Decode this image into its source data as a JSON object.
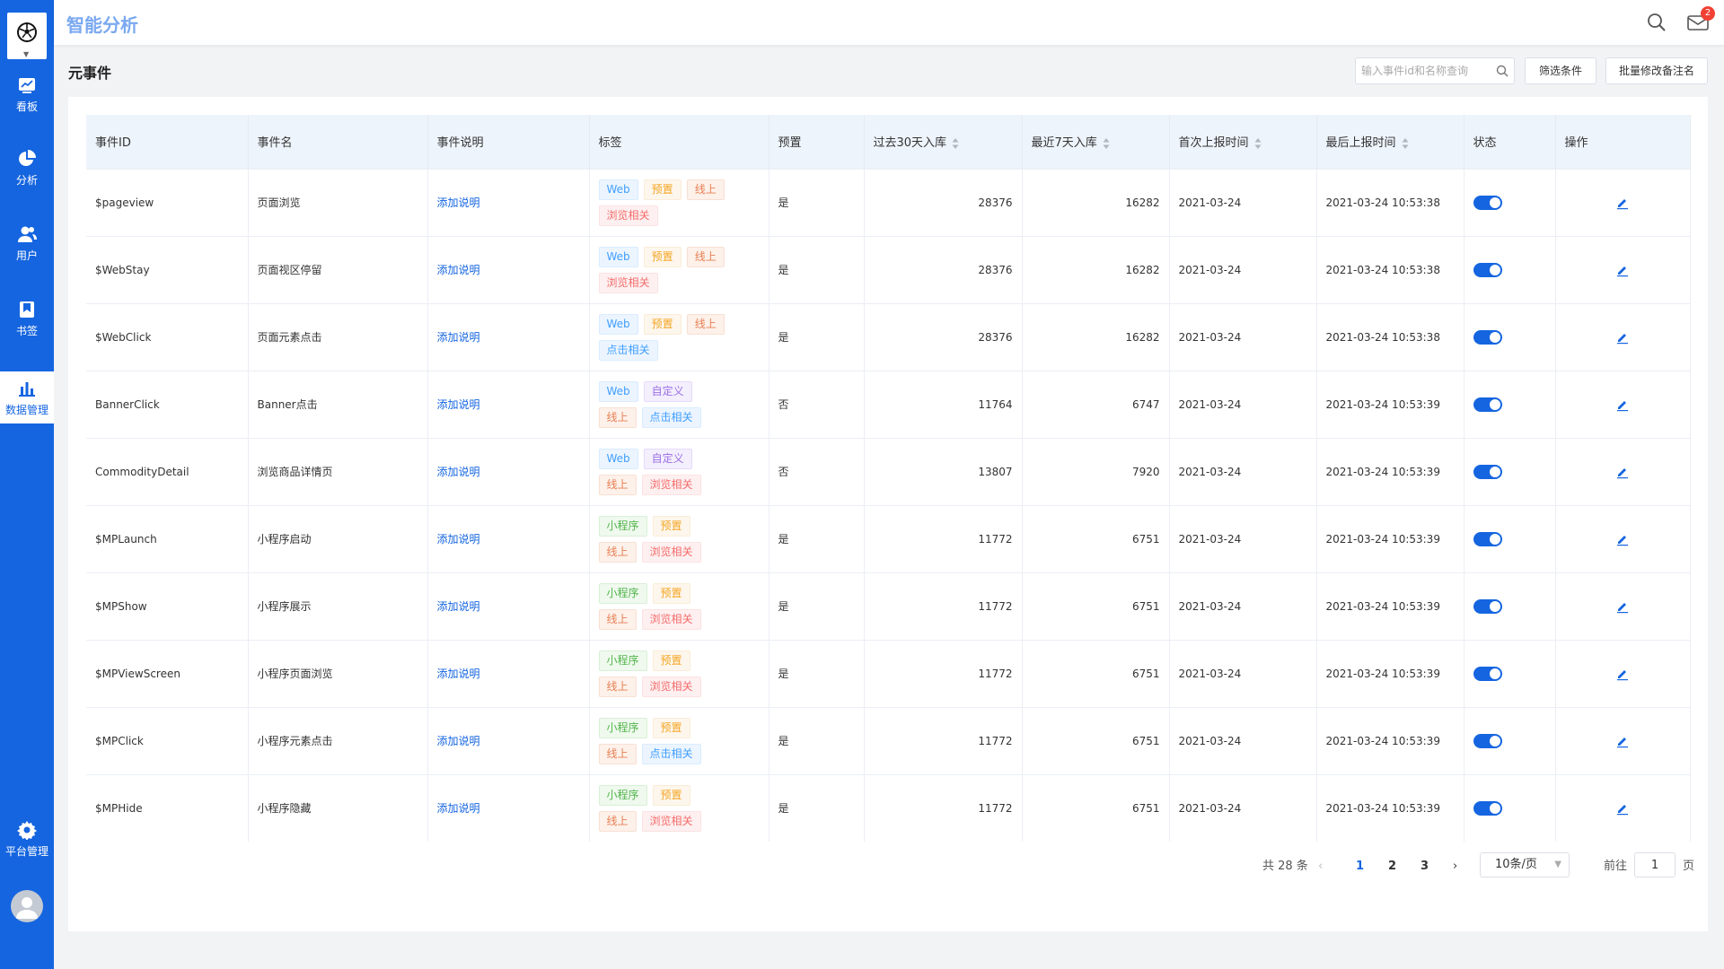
{
  "app": {
    "title": "智能分析",
    "mail_badge": "2"
  },
  "sidebar": {
    "items": [
      {
        "label": "看板",
        "icon": "dashboard-icon"
      },
      {
        "label": "分析",
        "icon": "pie-chart-icon"
      },
      {
        "label": "用户",
        "icon": "users-icon"
      },
      {
        "label": "书签",
        "icon": "bookmark-icon"
      },
      {
        "label": "数据管理",
        "icon": "bar-chart-icon",
        "active": true
      }
    ],
    "platform": {
      "label": "平台管理",
      "icon": "gear-icon"
    }
  },
  "toolbar": {
    "page_title": "元事件",
    "search_placeholder": "输入事件id和名称查询",
    "filter_label": "筛选条件",
    "batch_label": "批量修改备注名"
  },
  "table": {
    "headers": [
      "事件ID",
      "事件名",
      "事件说明",
      "标签",
      "预置",
      "过去30天入库",
      "最近7天入库",
      "首次上报时间",
      "最后上报时间",
      "状态",
      "操作"
    ],
    "rows": [
      {
        "id": "$pageview",
        "name": "页面浏览",
        "desc": "添加说明",
        "tags": [
          {
            "t": "Web",
            "c": "blue"
          },
          {
            "t": "预置",
            "c": "orange"
          },
          {
            "t": "线上",
            "c": "peach"
          },
          {
            "t": "浏览相关",
            "c": "pink"
          }
        ],
        "preset": "是",
        "d30": "28376",
        "d7": "16282",
        "first": "2021-03-24",
        "last": "2021-03-24 10:53:38",
        "enabled": true
      },
      {
        "id": "$WebStay",
        "name": "页面视区停留",
        "desc": "添加说明",
        "tags": [
          {
            "t": "Web",
            "c": "blue"
          },
          {
            "t": "预置",
            "c": "orange"
          },
          {
            "t": "线上",
            "c": "peach"
          },
          {
            "t": "浏览相关",
            "c": "pink"
          }
        ],
        "preset": "是",
        "d30": "28376",
        "d7": "16282",
        "first": "2021-03-24",
        "last": "2021-03-24 10:53:38",
        "enabled": true
      },
      {
        "id": "$WebClick",
        "name": "页面元素点击",
        "desc": "添加说明",
        "tags": [
          {
            "t": "Web",
            "c": "blue"
          },
          {
            "t": "预置",
            "c": "orange"
          },
          {
            "t": "线上",
            "c": "peach"
          },
          {
            "t": "点击相关",
            "c": "blue"
          }
        ],
        "preset": "是",
        "d30": "28376",
        "d7": "16282",
        "first": "2021-03-24",
        "last": "2021-03-24 10:53:38",
        "enabled": true
      },
      {
        "id": "BannerClick",
        "name": "Banner点击",
        "desc": "添加说明",
        "tags": [
          {
            "t": "Web",
            "c": "blue"
          },
          {
            "t": "自定义",
            "c": "purple"
          },
          {
            "t": "线上",
            "c": "peach"
          },
          {
            "t": "点击相关",
            "c": "blue"
          }
        ],
        "preset": "否",
        "d30": "11764",
        "d7": "6747",
        "first": "2021-03-24",
        "last": "2021-03-24 10:53:39",
        "enabled": true
      },
      {
        "id": "CommodityDetail",
        "name": "浏览商品详情页",
        "desc": "添加说明",
        "tags": [
          {
            "t": "Web",
            "c": "blue"
          },
          {
            "t": "自定义",
            "c": "purple"
          },
          {
            "t": "线上",
            "c": "peach"
          },
          {
            "t": "浏览相关",
            "c": "pink"
          }
        ],
        "preset": "否",
        "d30": "13807",
        "d7": "7920",
        "first": "2021-03-24",
        "last": "2021-03-24 10:53:39",
        "enabled": true
      },
      {
        "id": "$MPLaunch",
        "name": "小程序启动",
        "desc": "添加说明",
        "tags": [
          {
            "t": "小程序",
            "c": "green"
          },
          {
            "t": "预置",
            "c": "orange"
          },
          {
            "t": "线上",
            "c": "peach"
          },
          {
            "t": "浏览相关",
            "c": "pink"
          }
        ],
        "preset": "是",
        "d30": "11772",
        "d7": "6751",
        "first": "2021-03-24",
        "last": "2021-03-24 10:53:39",
        "enabled": true
      },
      {
        "id": "$MPShow",
        "name": "小程序展示",
        "desc": "添加说明",
        "tags": [
          {
            "t": "小程序",
            "c": "green"
          },
          {
            "t": "预置",
            "c": "orange"
          },
          {
            "t": "线上",
            "c": "peach"
          },
          {
            "t": "浏览相关",
            "c": "pink"
          }
        ],
        "preset": "是",
        "d30": "11772",
        "d7": "6751",
        "first": "2021-03-24",
        "last": "2021-03-24 10:53:39",
        "enabled": true
      },
      {
        "id": "$MPViewScreen",
        "name": "小程序页面浏览",
        "desc": "添加说明",
        "tags": [
          {
            "t": "小程序",
            "c": "green"
          },
          {
            "t": "预置",
            "c": "orange"
          },
          {
            "t": "线上",
            "c": "peach"
          },
          {
            "t": "浏览相关",
            "c": "pink"
          }
        ],
        "preset": "是",
        "d30": "11772",
        "d7": "6751",
        "first": "2021-03-24",
        "last": "2021-03-24 10:53:39",
        "enabled": true
      },
      {
        "id": "$MPClick",
        "name": "小程序元素点击",
        "desc": "添加说明",
        "tags": [
          {
            "t": "小程序",
            "c": "green"
          },
          {
            "t": "预置",
            "c": "orange"
          },
          {
            "t": "线上",
            "c": "peach"
          },
          {
            "t": "点击相关",
            "c": "blue"
          }
        ],
        "preset": "是",
        "d30": "11772",
        "d7": "6751",
        "first": "2021-03-24",
        "last": "2021-03-24 10:53:39",
        "enabled": true
      },
      {
        "id": "$MPHide",
        "name": "小程序隐藏",
        "desc": "添加说明",
        "tags": [
          {
            "t": "小程序",
            "c": "green"
          },
          {
            "t": "预置",
            "c": "orange"
          },
          {
            "t": "线上",
            "c": "peach"
          },
          {
            "t": "浏览相关",
            "c": "pink"
          }
        ],
        "preset": "是",
        "d30": "11772",
        "d7": "6751",
        "first": "2021-03-24",
        "last": "2021-03-24 10:53:39",
        "enabled": true
      }
    ]
  },
  "pagination": {
    "total": "共 28 条",
    "pages": [
      "1",
      "2",
      "3"
    ],
    "current": "1",
    "page_size": "10条/页",
    "goto_label": "前往",
    "goto_value": "1",
    "goto_unit": "页"
  },
  "colors": {
    "primary": "#1565e0",
    "header_bg": "#eef4fc"
  }
}
